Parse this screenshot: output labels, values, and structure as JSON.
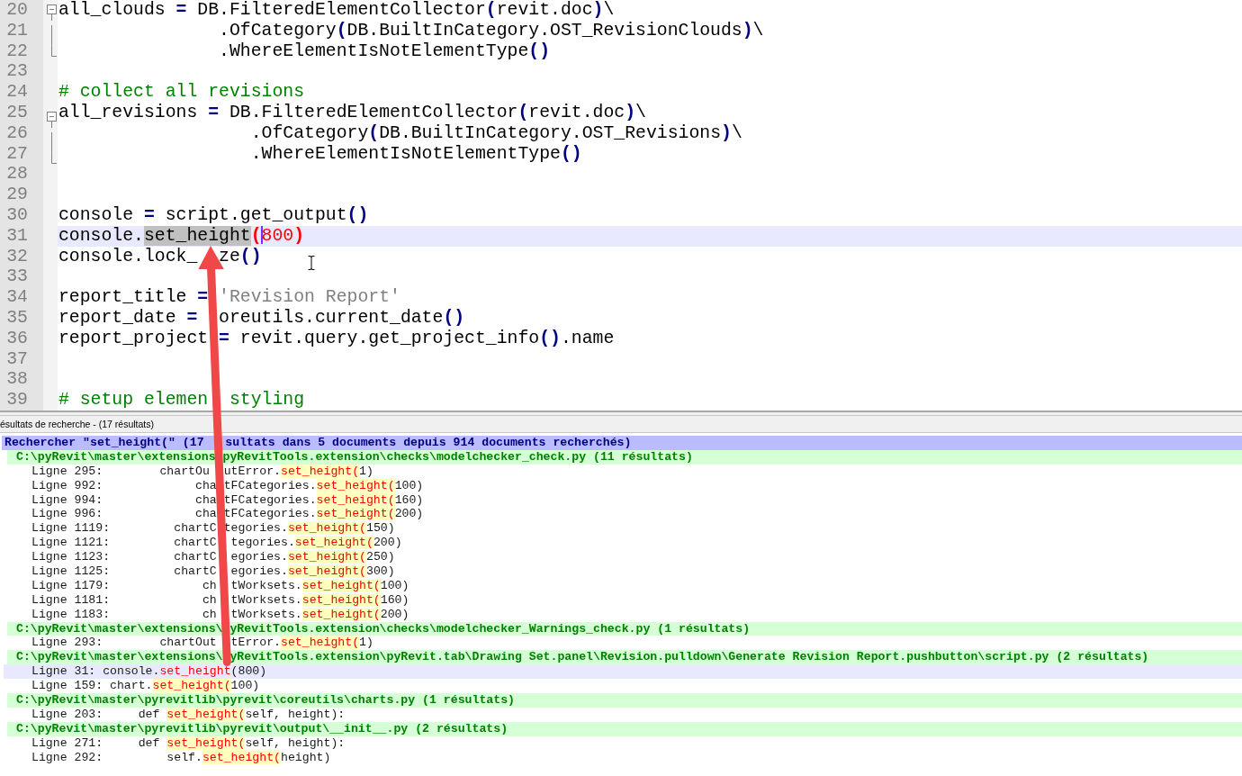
{
  "editor": {
    "lines": [
      {
        "number": "20",
        "kind": "foldhead",
        "selected": false,
        "tokens": [
          {
            "kind": "plain",
            "text": "all_clouds "
          },
          {
            "kind": "operator",
            "text": "="
          },
          {
            "kind": "plain",
            "text": " DB.FilteredElementCollector"
          },
          {
            "kind": "operator",
            "text": "("
          },
          {
            "kind": "plain",
            "text": "revit.doc"
          },
          {
            "kind": "operator",
            "text": ")"
          },
          {
            "kind": "plain",
            "text": "\\"
          }
        ]
      },
      {
        "number": "21",
        "kind": "foldbody",
        "selected": false,
        "tokens": [
          {
            "kind": "plain",
            "text": "               .OfCategory"
          },
          {
            "kind": "operator",
            "text": "("
          },
          {
            "kind": "plain",
            "text": "DB.BuiltInCategory.OST_RevisionClouds"
          },
          {
            "kind": "operator",
            "text": ")"
          },
          {
            "kind": "plain",
            "text": "\\"
          }
        ]
      },
      {
        "number": "22",
        "kind": "foldend",
        "selected": false,
        "tokens": [
          {
            "kind": "plain",
            "text": "               .WhereElementIsNotElementType"
          },
          {
            "kind": "operator",
            "text": "()"
          }
        ]
      },
      {
        "number": "23",
        "kind": "plain",
        "selected": false
      },
      {
        "number": "24",
        "kind": "plain",
        "selected": false,
        "tokens": [
          {
            "kind": "comment",
            "text": "# collect all revisions"
          }
        ]
      },
      {
        "number": "25",
        "kind": "foldhead",
        "selected": false,
        "tokens": [
          {
            "kind": "plain",
            "text": "all_revisions "
          },
          {
            "kind": "operator",
            "text": "="
          },
          {
            "kind": "plain",
            "text": " DB.FilteredElementCollector"
          },
          {
            "kind": "operator",
            "text": "("
          },
          {
            "kind": "plain",
            "text": "revit.doc"
          },
          {
            "kind": "operator",
            "text": ")"
          },
          {
            "kind": "plain",
            "text": "\\"
          }
        ]
      },
      {
        "number": "26",
        "kind": "foldbody",
        "selected": false,
        "tokens": [
          {
            "kind": "plain",
            "text": "                  .OfCategory"
          },
          {
            "kind": "operator",
            "text": "("
          },
          {
            "kind": "plain",
            "text": "DB.BuiltInCategory.OST_Revisions"
          },
          {
            "kind": "operator",
            "text": ")"
          },
          {
            "kind": "plain",
            "text": "\\"
          }
        ]
      },
      {
        "number": "27",
        "kind": "foldend",
        "selected": false,
        "tokens": [
          {
            "kind": "plain",
            "text": "                  .WhereElementIsNotElementType"
          },
          {
            "kind": "operator",
            "text": "()"
          }
        ]
      },
      {
        "number": "28",
        "kind": "plain",
        "selected": false
      },
      {
        "number": "29",
        "kind": "plain",
        "selected": false
      },
      {
        "number": "30",
        "kind": "plain",
        "selected": false,
        "tokens": [
          {
            "kind": "plain",
            "text": "console "
          },
          {
            "kind": "operator",
            "text": "="
          },
          {
            "kind": "plain",
            "text": " script.get_output"
          },
          {
            "kind": "operator",
            "text": "()"
          }
        ]
      },
      {
        "number": "31",
        "kind": "plain",
        "selected": true,
        "tokens": [
          {
            "kind": "plain",
            "text": "console."
          },
          {
            "kind": "selection",
            "text": "set_height"
          },
          {
            "kind": "brace",
            "text": "("
          },
          {
            "kind": "caret"
          },
          {
            "kind": "number",
            "text": "800"
          },
          {
            "kind": "brace",
            "text": ")"
          }
        ]
      },
      {
        "number": "32",
        "kind": "plain",
        "selected": false,
        "tokens": [
          {
            "kind": "plain",
            "text": "console.lock_"
          },
          {
            "kind": "covered"
          },
          {
            "kind": "plain",
            "text": "ze"
          },
          {
            "kind": "operator",
            "text": "()"
          }
        ]
      },
      {
        "number": "33",
        "kind": "plain",
        "selected": false
      },
      {
        "number": "34",
        "kind": "plain",
        "selected": false,
        "tokens": [
          {
            "kind": "plain",
            "text": "report_title "
          },
          {
            "kind": "operator",
            "text": "="
          },
          {
            "kind": "string",
            "text": " 'Revision Report'"
          }
        ]
      },
      {
        "number": "35",
        "kind": "plain",
        "selected": false,
        "tokens": [
          {
            "kind": "plain",
            "text": "report_date "
          },
          {
            "kind": "operator",
            "text": "="
          },
          {
            "kind": "covered"
          },
          {
            "kind": "plain",
            "text": "oreutils.current_date"
          },
          {
            "kind": "operator",
            "text": "()"
          }
        ]
      },
      {
        "number": "36",
        "kind": "plain",
        "selected": false,
        "tokens": [
          {
            "kind": "plain",
            "text": "report_project "
          },
          {
            "kind": "operator",
            "text": "="
          },
          {
            "kind": "plain",
            "text": " revit.query.get_project_info"
          },
          {
            "kind": "operator",
            "text": "()"
          },
          {
            "kind": "plain",
            "text": ".name"
          }
        ]
      },
      {
        "number": "37",
        "kind": "plain",
        "selected": false
      },
      {
        "number": "38",
        "kind": "plain",
        "selected": false
      },
      {
        "number": "39",
        "kind": "plain",
        "selected": false,
        "tokens": [
          {
            "kind": "comment",
            "text": "# setup elemen"
          },
          {
            "kind": "covered"
          },
          {
            "kind": "comment",
            "text": " styling"
          }
        ]
      }
    ]
  },
  "search_panel": {
    "title": "ésultats de recherche - (17 résultats)",
    "summary": [
      "Rechercher \"set_height(\" (17",
      "sultats dans 5 documents depuis 914 documents recherchés)"
    ],
    "files": [
      {
        "path": [
          "C:\\pyRevit\\master\\extensions",
          "pyRevitTools.extension\\checks\\modelchecker_check.py (11 résultats)"
        ],
        "hits": [
          {
            "line": "Ligne 295:",
            "selected": false,
            "tokens": [
              {
                "kind": "plain",
                "text": "       chartOu"
              },
              {
                "kind": "covered"
              },
              {
                "kind": "plain",
                "text": "utError."
              },
              {
                "kind": "match",
                "text": "set_height("
              },
              {
                "kind": "plain",
                "text": "1)"
              }
            ]
          },
          {
            "line": "Ligne 992:",
            "selected": false,
            "tokens": [
              {
                "kind": "plain",
                "text": "            cha"
              },
              {
                "kind": "covered"
              },
              {
                "kind": "plain",
                "text": "tFCategories."
              },
              {
                "kind": "match",
                "text": "set_height("
              },
              {
                "kind": "plain",
                "text": "100)"
              }
            ]
          },
          {
            "line": "Ligne 994:",
            "selected": false,
            "tokens": [
              {
                "kind": "plain",
                "text": "            cha"
              },
              {
                "kind": "covered"
              },
              {
                "kind": "plain",
                "text": "tFCategories."
              },
              {
                "kind": "match",
                "text": "set_height("
              },
              {
                "kind": "plain",
                "text": "160)"
              }
            ]
          },
          {
            "line": "Ligne 996:",
            "selected": false,
            "tokens": [
              {
                "kind": "plain",
                "text": "            cha"
              },
              {
                "kind": "covered"
              },
              {
                "kind": "plain",
                "text": "tFCategories."
              },
              {
                "kind": "match",
                "text": "set_height("
              },
              {
                "kind": "plain",
                "text": "200)"
              }
            ]
          },
          {
            "line": "Ligne 1119:",
            "selected": false,
            "tokens": [
              {
                "kind": "plain",
                "text": "        chartC"
              },
              {
                "kind": "covered"
              },
              {
                "kind": "plain",
                "text": "tegories."
              },
              {
                "kind": "match",
                "text": "set_height("
              },
              {
                "kind": "plain",
                "text": "150)"
              }
            ]
          },
          {
            "line": "Ligne 1121:",
            "selected": false,
            "tokens": [
              {
                "kind": "plain",
                "text": "        chartC"
              },
              {
                "kind": "covered"
              },
              {
                "kind": "plain",
                "text": "tegories."
              },
              {
                "kind": "match",
                "text": "set_height("
              },
              {
                "kind": "plain",
                "text": "200)"
              }
            ]
          },
          {
            "line": "Ligne 1123:",
            "selected": false,
            "tokens": [
              {
                "kind": "plain",
                "text": "        chartC"
              },
              {
                "kind": "covered"
              },
              {
                "kind": "plain",
                "text": "egories."
              },
              {
                "kind": "match",
                "text": "set_height("
              },
              {
                "kind": "plain",
                "text": "250)"
              }
            ]
          },
          {
            "line": "Ligne 1125:",
            "selected": false,
            "tokens": [
              {
                "kind": "plain",
                "text": "        chartC"
              },
              {
                "kind": "covered"
              },
              {
                "kind": "plain",
                "text": "egories."
              },
              {
                "kind": "match",
                "text": "set_height("
              },
              {
                "kind": "plain",
                "text": "300)"
              }
            ]
          },
          {
            "line": "Ligne 1179:",
            "selected": false,
            "tokens": [
              {
                "kind": "plain",
                "text": "            ch"
              },
              {
                "kind": "covered"
              },
              {
                "kind": "plain",
                "text": "tWorksets."
              },
              {
                "kind": "match",
                "text": "set_height("
              },
              {
                "kind": "plain",
                "text": "100)"
              }
            ]
          },
          {
            "line": "Ligne 1181:",
            "selected": false,
            "tokens": [
              {
                "kind": "plain",
                "text": "            ch"
              },
              {
                "kind": "covered"
              },
              {
                "kind": "plain",
                "text": "tWorksets."
              },
              {
                "kind": "match",
                "text": "set_height("
              },
              {
                "kind": "plain",
                "text": "160)"
              }
            ]
          },
          {
            "line": "Ligne 1183:",
            "selected": false,
            "tokens": [
              {
                "kind": "plain",
                "text": "            ch"
              },
              {
                "kind": "covered"
              },
              {
                "kind": "plain",
                "text": "tWorksets."
              },
              {
                "kind": "match",
                "text": "set_height("
              },
              {
                "kind": "plain",
                "text": "200)"
              }
            ]
          }
        ]
      },
      {
        "path": [
          "C:\\pyRevit\\master\\extensions\\",
          "yRevitTools.extension\\checks\\modelchecker_Warnings_check.py (1 résultats)"
        ],
        "hits": [
          {
            "line": "Ligne 293:",
            "selected": false,
            "tokens": [
              {
                "kind": "plain",
                "text": "       chartOut"
              },
              {
                "kind": "covered"
              },
              {
                "kind": "plain",
                "text": "tError."
              },
              {
                "kind": "match",
                "text": "set_height("
              },
              {
                "kind": "plain",
                "text": "1)"
              }
            ]
          }
        ]
      },
      {
        "path": [
          "C:\\pyRevit\\master\\extensions\\",
          "yRevitTools.extension\\pyRevit.tab\\Drawing Set.panel\\Revision.pulldown\\Generate Revision Report.pushbutton\\script.py (2 résultats)"
        ],
        "hits": [
          {
            "line": "Ligne 31:",
            "selected": true,
            "tokens": [
              {
                "kind": "plain",
                "text": "console."
              },
              {
                "kind": "match",
                "text": "set_height"
              },
              {
                "kind": "plain",
                "text": "(800)"
              }
            ]
          },
          {
            "line": "Ligne 159:",
            "selected": false,
            "tokens": [
              {
                "kind": "plain",
                "text": "chart."
              },
              {
                "kind": "match",
                "text": "set_height("
              },
              {
                "kind": "plain",
                "text": "100)"
              }
            ]
          }
        ]
      },
      {
        "path": [
          "C:\\pyRevit\\master\\pyrevitlib\\pyrevit\\coreutils\\charts.py (1 résultats)"
        ],
        "hits": [
          {
            "line": "Ligne 203:",
            "selected": false,
            "tokens": [
              {
                "kind": "plain",
                "text": "    def "
              },
              {
                "kind": "match",
                "text": "set_height("
              },
              {
                "kind": "plain",
                "text": "self, height):"
              }
            ]
          }
        ]
      },
      {
        "path": [
          "C:\\pyRevit\\master\\pyrevitlib\\pyrevit\\output\\__init__.py (2 résultats)"
        ],
        "hits": [
          {
            "line": "Ligne 271:",
            "selected": false,
            "tokens": [
              {
                "kind": "plain",
                "text": "    def "
              },
              {
                "kind": "match",
                "text": "set_height("
              },
              {
                "kind": "plain",
                "text": "self, height):"
              }
            ]
          },
          {
            "line": "Ligne 292:",
            "selected": false,
            "tokens": [
              {
                "kind": "plain",
                "text": "        self."
              },
              {
                "kind": "match",
                "text": "set_height("
              },
              {
                "kind": "plain",
                "text": "height)"
              }
            ]
          }
        ]
      }
    ]
  }
}
